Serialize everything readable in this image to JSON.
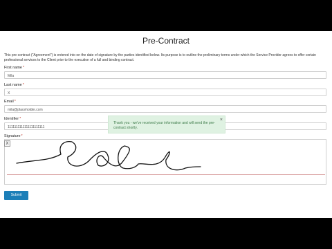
{
  "page": {
    "title": "Pre-Contract",
    "intro": "This pre-contract (\"Agreement\") is entered into on the date of signature by the parties identified below. Its purpose is to outline the preliminary terms under which the Service Provider agrees to offer certain professional services to the Client prior to the execution of a full and binding contract."
  },
  "form": {
    "first_name": {
      "label": "First name",
      "required": "*",
      "value": "Mila"
    },
    "last_name": {
      "label": "Last name",
      "required": "*",
      "value": "X"
    },
    "email": {
      "label": "Email",
      "required": "*",
      "value": "mila@placeholder.com"
    },
    "identifier": {
      "label": "Identifier",
      "required": "*",
      "value": "1111111111111111111111"
    },
    "signature": {
      "label": "Signature",
      "required": "*",
      "clear_label": "X"
    },
    "submit_label": "Submit"
  },
  "toast": {
    "message": "Thank you - we've received your information and will send the pre-contract shortly.",
    "close_label": "×"
  },
  "colors": {
    "submit": "#1d7fb8",
    "toast_bg": "#dff2e2",
    "toast_text": "#3c7a48",
    "required": "#c0392b"
  }
}
